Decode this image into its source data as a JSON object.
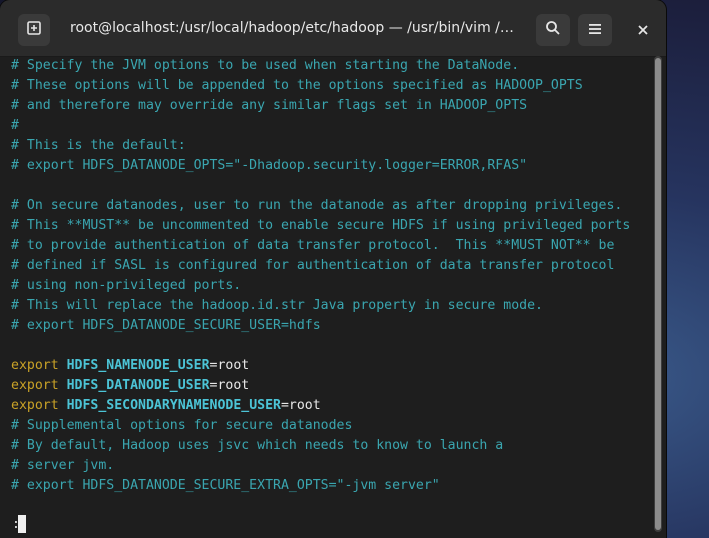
{
  "window": {
    "title": "root@localhost:/usr/local/hadoop/etc/hadoop — /usr/bin/vim /…"
  },
  "icons": {
    "new_tab": "new-tab-icon",
    "search": "search-icon",
    "menu": "hamburger-menu-icon",
    "close": "close-icon"
  },
  "colors": {
    "comment": "#3aa6b0",
    "keyword": "#c9a227",
    "variable": "#4cc4d6",
    "text": "#e8e8e8",
    "background": "#1e1e1e"
  },
  "editor": {
    "lines": [
      {
        "t": "comment",
        "text": "# Specify the JVM options to be used when starting the DataNode."
      },
      {
        "t": "comment",
        "text": "# These options will be appended to the options specified as HADOOP_OPTS"
      },
      {
        "t": "comment",
        "text": "# and therefore may override any similar flags set in HADOOP_OPTS"
      },
      {
        "t": "comment",
        "text": "#"
      },
      {
        "t": "comment",
        "text": "# This is the default:"
      },
      {
        "t": "comment",
        "text": "# export HDFS_DATANODE_OPTS=\"-Dhadoop.security.logger=ERROR,RFAS\""
      },
      {
        "t": "blank",
        "text": ""
      },
      {
        "t": "comment",
        "text": "# On secure datanodes, user to run the datanode as after dropping privileges."
      },
      {
        "t": "comment",
        "text": "# This **MUST** be uncommented to enable secure HDFS if using privileged ports"
      },
      {
        "t": "comment",
        "text": "# to provide authentication of data transfer protocol.  This **MUST NOT** be"
      },
      {
        "t": "comment",
        "text": "# defined if SASL is configured for authentication of data transfer protocol"
      },
      {
        "t": "comment",
        "text": "# using non-privileged ports."
      },
      {
        "t": "comment",
        "text": "# This will replace the hadoop.id.str Java property in secure mode."
      },
      {
        "t": "comment",
        "text": "# export HDFS_DATANODE_SECURE_USER=hdfs"
      },
      {
        "t": "blank",
        "text": ""
      },
      {
        "t": "export",
        "kw": "export",
        "var": "HDFS_NAMENODE_USER",
        "val": "=root"
      },
      {
        "t": "export",
        "kw": "export",
        "var": "HDFS_DATANODE_USER",
        "val": "=root"
      },
      {
        "t": "export",
        "kw": "export",
        "var": "HDFS_SECONDARYNAMENODE_USER",
        "val": "=root"
      },
      {
        "t": "comment",
        "text": "# Supplemental options for secure datanodes"
      },
      {
        "t": "comment",
        "text": "# By default, Hadoop uses jsvc which needs to know to launch a"
      },
      {
        "t": "comment",
        "text": "# server jvm."
      },
      {
        "t": "comment",
        "text": "# export HDFS_DATANODE_SECURE_EXTRA_OPTS=\"-jvm server\""
      }
    ],
    "command_line": ":"
  }
}
